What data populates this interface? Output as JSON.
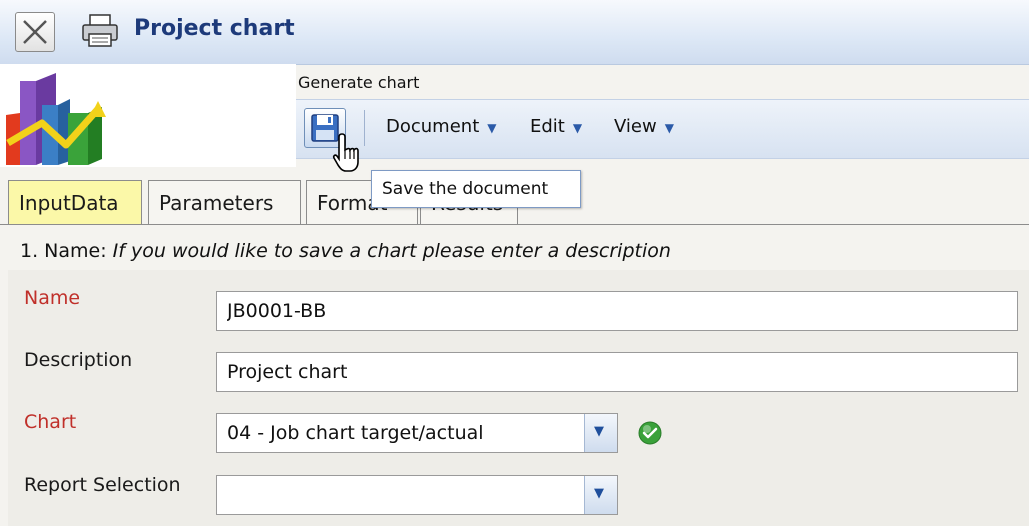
{
  "window": {
    "title": "Project chart"
  },
  "header": {
    "generate_label": "Generate chart"
  },
  "toolbar": {
    "menus": [
      {
        "label": "Document"
      },
      {
        "label": "Edit"
      },
      {
        "label": "View"
      }
    ],
    "menu_arrow": "▼",
    "save_tooltip": "Save the document"
  },
  "tabs": [
    {
      "label": "InputData",
      "active": true
    },
    {
      "label": "Parameters"
    },
    {
      "label": "Format"
    },
    {
      "label": "Results"
    }
  ],
  "section": {
    "prefix": "1. Name: ",
    "hint": "If you would like to save a chart please enter a description"
  },
  "form": {
    "name_label": "Name",
    "name_value": "JB0001-BB",
    "description_label": "Description",
    "description_value": "Project chart",
    "chart_label": "Chart",
    "chart_value": "04 - Job chart target/actual",
    "report_label": "Report Selection",
    "report_value": ""
  },
  "icons": {
    "close": "close-icon",
    "print": "print-icon",
    "save": "save-icon",
    "ok": "check-circle-icon",
    "dropdown": "chevron-down-icon"
  },
  "colors": {
    "title": "#1d3a7a",
    "required_label": "#c0302a",
    "active_tab": "#fbf8a8",
    "ok_green": "#3aa13a"
  }
}
